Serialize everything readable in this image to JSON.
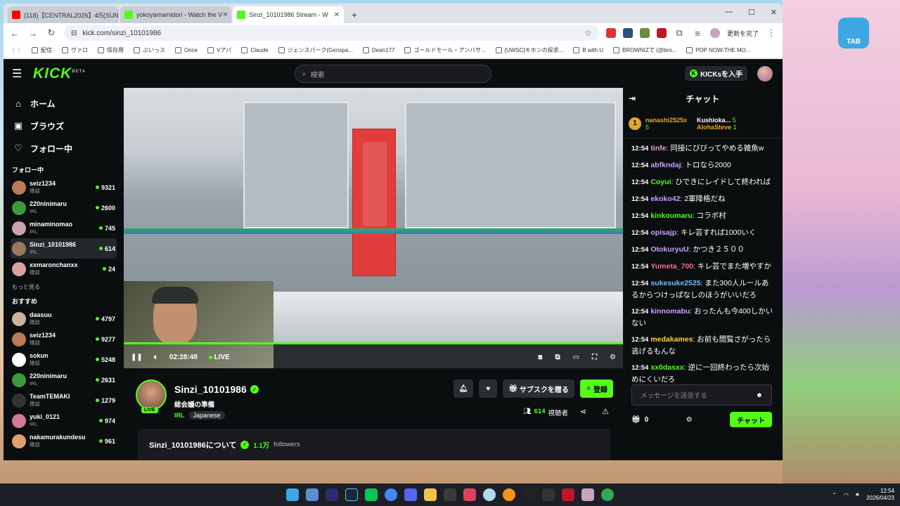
{
  "browser": {
    "tabs": [
      {
        "title": "(118)【CENTRAL2026】4/5(SUN)",
        "favicon_color": "#ff0000"
      },
      {
        "title": "yokoyamamidori - Watch the V",
        "favicon_color": "#53fc18"
      },
      {
        "title": "Sinzi_10101986 Stream - W",
        "favicon_color": "#53fc18"
      }
    ],
    "url": "kick.com/sinzi_10101986",
    "update_label": "更新を完了",
    "bookmarks": [
      "配信",
      "ヴァロ",
      "保存用",
      "ぷいっス",
      "Once",
      "Vアパ",
      "Claude",
      "ジェンスパーク(Genspa...",
      "Dean177",
      "ゴールドモール・アンバサ...",
      "[UWSC]キホンの探求...",
      "B with U",
      "BROWNIZで (@bro...",
      "POP NOW:THE MO..."
    ]
  },
  "kick": {
    "logo": "KICK",
    "logo_tag": "BETA",
    "search_placeholder": "検索",
    "get_kicks": "KICKsを入手",
    "nav": [
      {
        "label": "ホーム",
        "icon": "home-icon",
        "glyph": "⌂"
      },
      {
        "label": "ブラウズ",
        "icon": "browse-icon",
        "glyph": "▣"
      },
      {
        "label": "フォロー中",
        "icon": "heart-icon",
        "glyph": "♡"
      }
    ],
    "following_title": "フォロー中",
    "following": [
      {
        "name": "seiz1234",
        "cat": "雑談",
        "viewers": "9321",
        "color": "#b87a5a"
      },
      {
        "name": "220ninimaru",
        "cat": "IRL",
        "viewers": "2600",
        "color": "#3a9a3a"
      },
      {
        "name": "minaminomao",
        "cat": "IRL",
        "viewers": "745",
        "color": "#c9a3b0"
      },
      {
        "name": "Sinzi_10101986",
        "cat": "IRL",
        "viewers": "614",
        "color": "#9a7a5a"
      },
      {
        "name": "xxmaronchanxx",
        "cat": "雑談",
        "viewers": "24",
        "color": "#d9a0a0"
      }
    ],
    "show_more": "もっと見る",
    "recommended_title": "おすすめ",
    "recommended": [
      {
        "name": "daasuu",
        "cat": "雑談",
        "viewers": "4797",
        "color": "#c9b39a"
      },
      {
        "name": "seiz1234",
        "cat": "雑談",
        "viewers": "9277",
        "color": "#b87a5a"
      },
      {
        "name": "sokun",
        "cat": "雑談",
        "viewers": "5248",
        "color": "#ffffff"
      },
      {
        "name": "220ninimaru",
        "cat": "IRL",
        "viewers": "2631",
        "color": "#3a9a3a"
      },
      {
        "name": "TeamTEMAKI",
        "cat": "雑談",
        "viewers": "1279",
        "color": "#333333"
      },
      {
        "name": "yuki_0121",
        "cat": "IRL",
        "viewers": "974",
        "color": "#d07a9a"
      },
      {
        "name": "nakamurakundesu",
        "cat": "雑談",
        "viewers": "961",
        "color": "#e0a070"
      }
    ],
    "player": {
      "time": "02:28:48",
      "live": "LIVE"
    },
    "stream": {
      "name": "Sinzi_10101986",
      "title": "総会議の準備",
      "category": "IRL",
      "tag": "Japanese",
      "live_badge": "LIVE",
      "subscribe": "サブスクを贈る",
      "follow": "登録",
      "viewers": "614",
      "viewers_label": "視聴者",
      "about": "Sinzi_10101986について",
      "followers": "1.1万",
      "followers_label": "followers"
    },
    "chat": {
      "title": "チャット",
      "leaders": [
        {
          "rank": "1",
          "name": "nanashi2525x",
          "count": "5",
          "color": "#e0a72b"
        },
        {
          "name": "Kushioka...",
          "count": "5",
          "color": "#ffffff"
        },
        {
          "name": "AlohaSteve",
          "count": "1",
          "color": "#e0a72b"
        }
      ],
      "messages": [
        {
          "time": "12:54",
          "user": "tinfe",
          "color": "#e89bd0",
          "text": "同接にびびってやめる雑魚w"
        },
        {
          "time": "12:54",
          "user": "abfkndaj",
          "color": "#c8a0ff",
          "text": "トロなら2000"
        },
        {
          "time": "12:54",
          "user": "Coyui",
          "color": "#53fc18",
          "text": "ひできにレイドして終われば"
        },
        {
          "time": "12:54",
          "user": "ekoko42",
          "color": "#c8a0ff",
          "text": "2軍降格だね"
        },
        {
          "time": "12:54",
          "user": "kinkoumaru",
          "color": "#53fc18",
          "text": "コラボ村"
        },
        {
          "time": "12:54",
          "user": "opisajp",
          "color": "#c8a0ff",
          "text": "キレ芸すれば1000いく"
        },
        {
          "time": "12:54",
          "user": "OtokuryuU",
          "color": "#c8a0ff",
          "text": "かつき２５００"
        },
        {
          "time": "12:54",
          "user": "Yumeta_700",
          "color": "#ff6b8a",
          "text": "キレ芸でまた増やすか"
        },
        {
          "time": "12:54",
          "user": "sukesuke2525",
          "color": "#7ab8ff",
          "text": "また300人ルールあるからつけっぱなしのほうがいいだろ"
        },
        {
          "time": "12:54",
          "user": "kinnomabu",
          "color": "#c8a0ff",
          "text": "おったんも今400しかいない"
        },
        {
          "time": "12:54",
          "user": "medakames",
          "color": "#ffd23f",
          "text": "お前も閲覧さがったら逃げるもんな"
        },
        {
          "time": "12:54",
          "user": "xx0dasxx",
          "color": "#53fc18",
          "text": "逆に一回終わったら次始めにくいだろ"
        }
      ],
      "input_placeholder": "メッセージを送信する",
      "points": "0",
      "send": "チャット"
    }
  },
  "desktop": {
    "tab_badge": "TAB",
    "clock_time": "12:54",
    "clock_date": "2026/04/23"
  }
}
